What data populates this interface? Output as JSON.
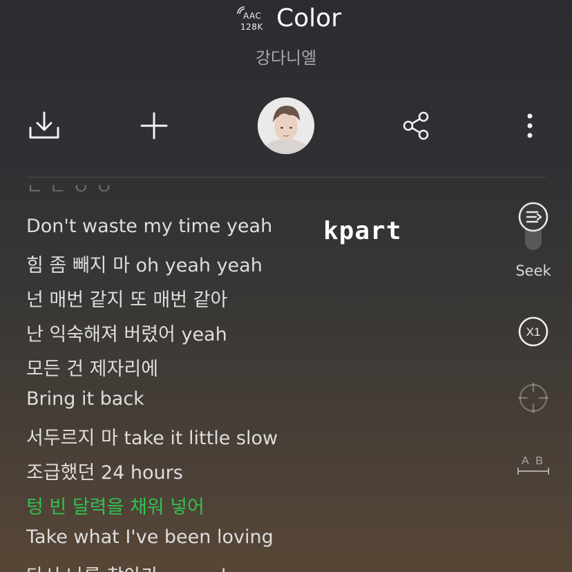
{
  "header": {
    "quality_codec": "AAC",
    "quality_bitrate": "128K",
    "title": "Color",
    "artist": "강다니엘"
  },
  "toolbar": {
    "download_icon": "download-icon",
    "add_icon": "plus-icon",
    "share_icon": "share-icon",
    "more_icon": "more-vertical-icon"
  },
  "lyrics": {
    "partial_top": "ㄴ ㄷ ㅇ ㅇ",
    "lines": [
      "Don't waste my time yeah",
      "힘 좀 빼지 마 oh yeah yeah",
      "넌 매번 같지 또 매번 같아",
      "난 익숙해져 버렸어 yeah",
      "모든 건 제자리에",
      "Bring it back",
      "서두르지 마 take it little slow",
      "조급했던 24 hours",
      "텅 빈 달력을 채워 넣어",
      "Take what I've been loving",
      "다시 나를 찾아가 my color"
    ],
    "current_index": 8,
    "highlight_color": "#31c152"
  },
  "watermark": "kpart",
  "side_controls": {
    "seek_label": "Seek",
    "speed_label": "X1",
    "ab_label": "A B"
  }
}
